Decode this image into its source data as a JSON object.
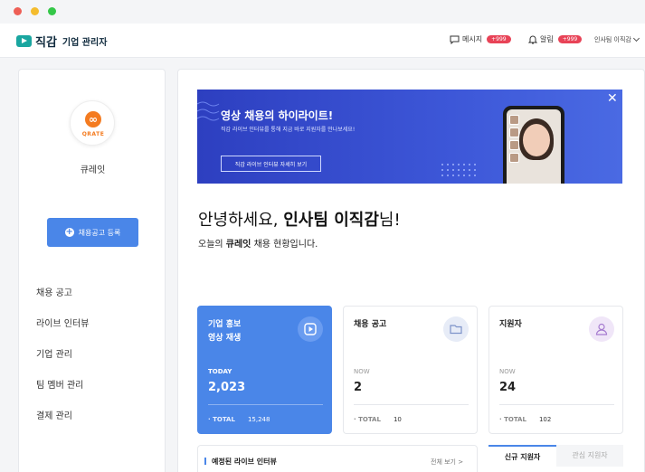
{
  "app": {
    "logo_text": "직감",
    "logo_sub": "기업 관리자"
  },
  "topbar": {
    "messages_label": "메시지",
    "messages_badge": "+999",
    "alerts_label": "알림",
    "alerts_badge": "+999",
    "user_name": "인사팀 이직감"
  },
  "sidebar": {
    "company_brand": "QRATE",
    "company_name": "큐레잇",
    "post_button": "채용공고 등록",
    "menu": [
      "채용 공고",
      "라이브 인터뷰",
      "기업 관리",
      "팀 멤버 관리",
      "결제 관리"
    ]
  },
  "banner": {
    "title": "영상 채용의 하이라이트!",
    "subtitle": "직감 라이브 인터뷰를 통해 지금 바로 지원자를 만나보세요!",
    "button": "직감 라이브 인터뷰 자세히 보기"
  },
  "greeting": {
    "prefix": "안녕하세요, ",
    "name": "인사팀 이직감",
    "suffix": "님!",
    "sub_prefix": "오늘의 ",
    "sub_company": "큐레잇",
    "sub_suffix": " 채용 현황입니다."
  },
  "cards": [
    {
      "title_line1": "기업 홍보",
      "title_line2": "영상 재생",
      "period": "TODAY",
      "value": "2,023",
      "total_label": "· TOTAL",
      "total_value": "15,248"
    },
    {
      "title_line1": "채용 공고",
      "title_line2": "",
      "period": "NOW",
      "value": "2",
      "total_label": "· TOTAL",
      "total_value": "10"
    },
    {
      "title_line1": "지원자",
      "title_line2": "",
      "period": "NOW",
      "value": "24",
      "total_label": "· TOTAL",
      "total_value": "102"
    }
  ],
  "upcoming": {
    "title": "예정된 라이브 인터뷰",
    "more": "전체 보기 >"
  },
  "applicant_tabs": {
    "active": "신규 지원자",
    "inactive": "관심 지원자"
  },
  "colors": {
    "primary": "#4a86e8",
    "banner": "#3d57d8",
    "badge": "#e84357",
    "logo": "#1aa6a0"
  }
}
